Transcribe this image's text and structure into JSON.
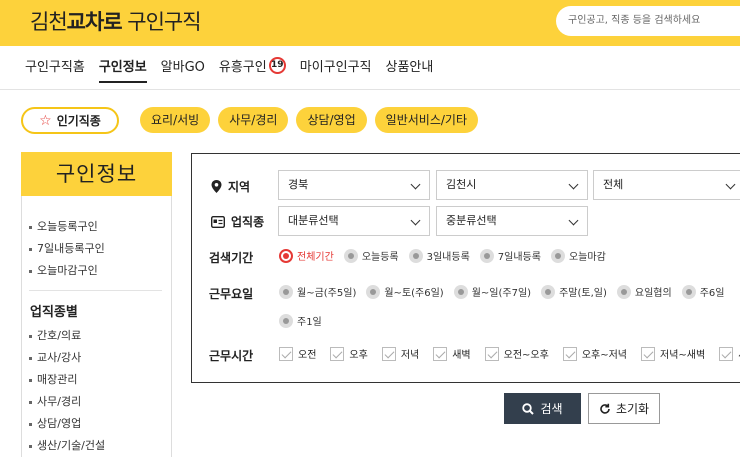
{
  "header": {
    "logo_light_1": "김천",
    "logo_bold": "교차로",
    "logo_light_2": "구인구직",
    "search_placeholder": "구인공고, 직종 등을 검색하세요"
  },
  "nav": {
    "items": [
      "구인구직홈",
      "구인정보",
      "알바GO",
      "유흥구인",
      "마이구인구직",
      "상품안내"
    ],
    "badge": "19"
  },
  "popular_label": "인기직종",
  "chips": [
    "요리/서빙",
    "사무/경리",
    "상담/영업",
    "일반서비스/기타"
  ],
  "sidebar": {
    "title": "구인정보",
    "quick": [
      "오늘등록구인",
      "7일내등록구인",
      "오늘마감구인"
    ],
    "heading": "업직종별",
    "categories": [
      "간호/의료",
      "교사/강사",
      "매장관리",
      "사무/경리",
      "상담/영업",
      "생산/기술/건설"
    ]
  },
  "filter": {
    "region_label": "지역",
    "region": [
      "경북",
      "김천시",
      "전체"
    ],
    "job_label": "업직종",
    "job": [
      "대분류선택",
      "중분류선택"
    ],
    "period_label": "검색기간",
    "period": [
      "전체기간",
      "오늘등록",
      "3일내등록",
      "7일내등록",
      "오늘마감"
    ],
    "days_label": "근무요일",
    "days": [
      "월~금(주5일)",
      "월~토(주6일)",
      "월~일(주7일)",
      "주말(토,일)",
      "요일협의",
      "주6일",
      "주1일"
    ],
    "hours_label": "근무시간",
    "hours": [
      "오전",
      "오후",
      "저녁",
      "새벽",
      "오전~오후",
      "오후~저녁",
      "저녁~새벽",
      "새벽"
    ],
    "search_btn": "검색",
    "reset_btn": "초기화"
  }
}
